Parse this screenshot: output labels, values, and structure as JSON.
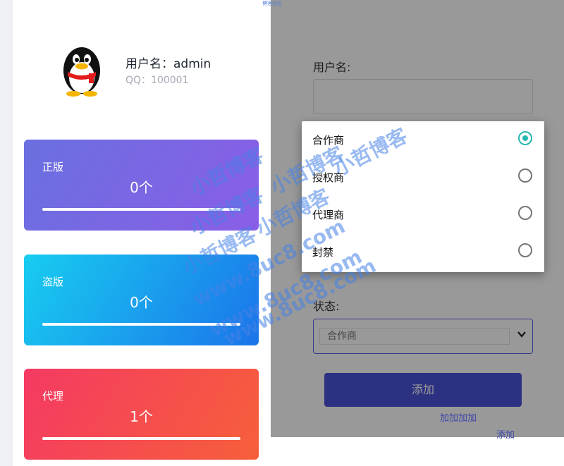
{
  "profile": {
    "username": "用户名：admin",
    "qq": "QQ：100001",
    "avatar_icon": "qq-penguin-icon"
  },
  "stats": [
    {
      "label": "正版",
      "value": "0个",
      "progress": 1.0
    },
    {
      "label": "盗版",
      "value": "0个",
      "progress": 1.0
    },
    {
      "label": "代理",
      "value": "1个",
      "progress": 1.0
    }
  ],
  "form": {
    "username_label": "用户名:",
    "username_value": "",
    "status_label": "状态:",
    "status_selected": "合作商",
    "add_button": "添加"
  },
  "dropdown": {
    "options": [
      {
        "label": "合作商",
        "checked": true
      },
      {
        "label": "授权商",
        "checked": false
      },
      {
        "label": "代理商",
        "checked": false
      },
      {
        "label": "封禁",
        "checked": false
      }
    ]
  },
  "watermark": {
    "cn": "小哲博客",
    "url": "www.8uc8.com",
    "corner": "博客社区"
  },
  "artifacts": {
    "t1": "加加加加",
    "t2": "添加"
  },
  "colors": {
    "accent": "#4a52d9",
    "radio_checked": "#26b8b0",
    "card_zhengban": "#6a6fe0",
    "card_daoban": "#1b74ea",
    "card_daili": "#f53a63"
  }
}
